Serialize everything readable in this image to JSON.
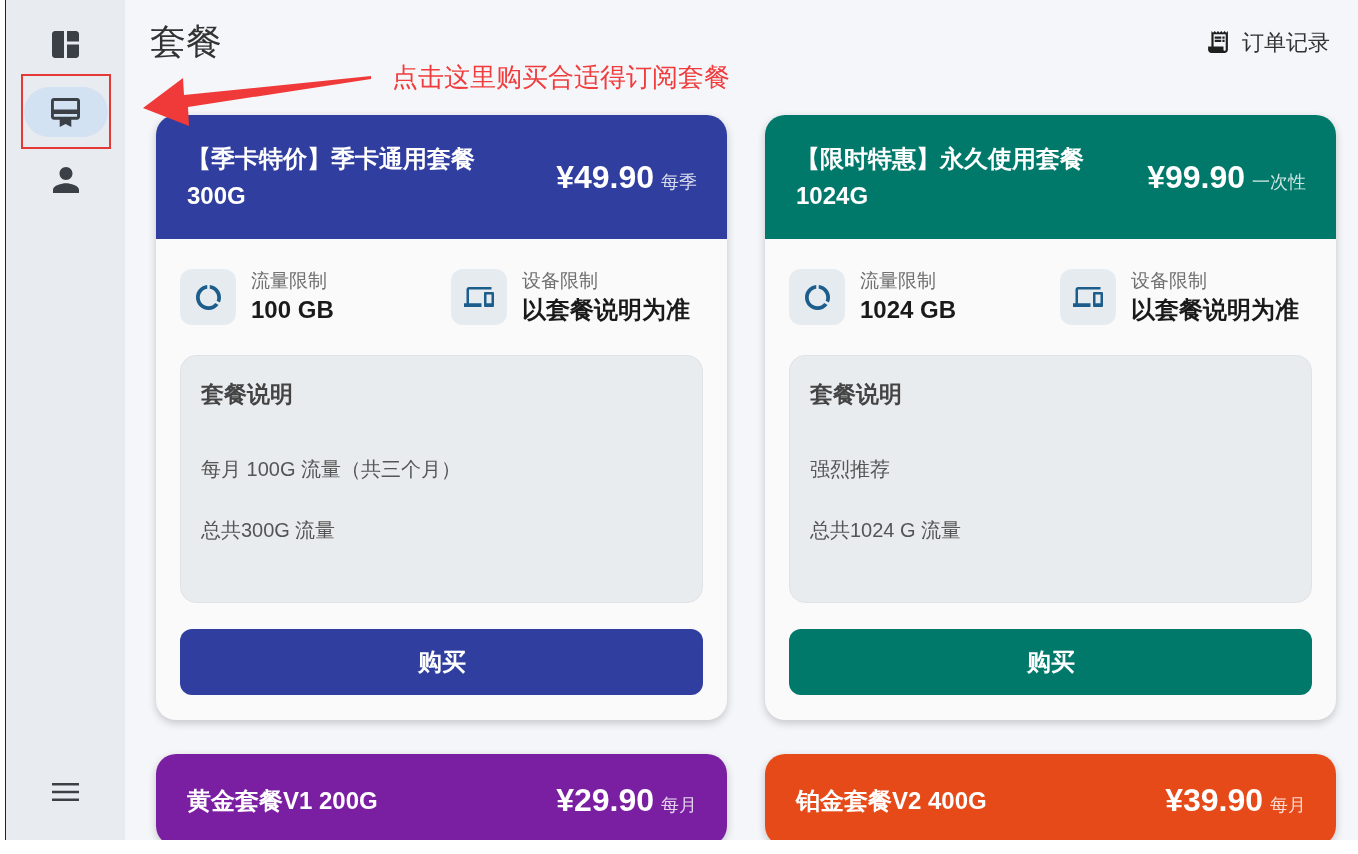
{
  "sidebar": {
    "items": [
      {
        "selected": false
      },
      {
        "selected": true
      },
      {
        "selected": false
      }
    ]
  },
  "page_title": "套餐",
  "order_history": "订单记录",
  "annotation": {
    "text": "点击这里购买合适得订阅套餐"
  },
  "plans": [
    {
      "title": "【季卡特价】季卡通用套餐 300G",
      "price": "¥49.90",
      "period": "每季",
      "color": "#303f9f",
      "features": [
        {
          "label": "流量限制",
          "value": "100 GB"
        },
        {
          "label": "设备限制",
          "value": "以套餐说明为准"
        }
      ],
      "description": {
        "heading": "套餐说明",
        "lines": [
          "每月 100G 流量（共三个月）",
          "总共300G 流量"
        ]
      },
      "button": "购买"
    },
    {
      "title": "【限时特惠】永久使用套餐 1024G",
      "price": "¥99.90",
      "period": "一次性",
      "color": "#00796b",
      "features": [
        {
          "label": "流量限制",
          "value": "1024 GB"
        },
        {
          "label": "设备限制",
          "value": "以套餐说明为准"
        }
      ],
      "description": {
        "heading": "套餐说明",
        "lines": [
          "强烈推荐",
          "总共1024 G 流量"
        ]
      },
      "button": "购买"
    },
    {
      "title": "黄金套餐V1 200G",
      "price": "¥29.90",
      "period": "每月",
      "color": "#7b1fa2"
    },
    {
      "title": "铂金套餐V2 400G",
      "price": "¥39.90",
      "period": "每月",
      "color": "#e64a19"
    }
  ]
}
